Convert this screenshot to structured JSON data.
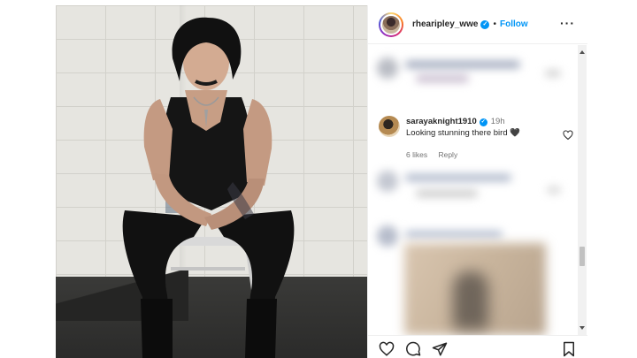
{
  "post": {
    "username": "rhearipley_wwe",
    "separator": "•",
    "follow_label": "Follow",
    "more_icon": "more-options-icon",
    "verified_icon": "verified-badge-icon"
  },
  "comment": {
    "username": "sarayaknight1910",
    "time": "19h",
    "text": "Looking stunning there bird 🖤",
    "likes": "6 likes",
    "reply_label": "Reply"
  },
  "actions": {
    "icons": [
      "heart-icon",
      "comment-icon",
      "share-icon",
      "save-icon"
    ]
  },
  "colors": {
    "accent": "#0095f6",
    "text": "#262626",
    "muted": "#737373"
  }
}
